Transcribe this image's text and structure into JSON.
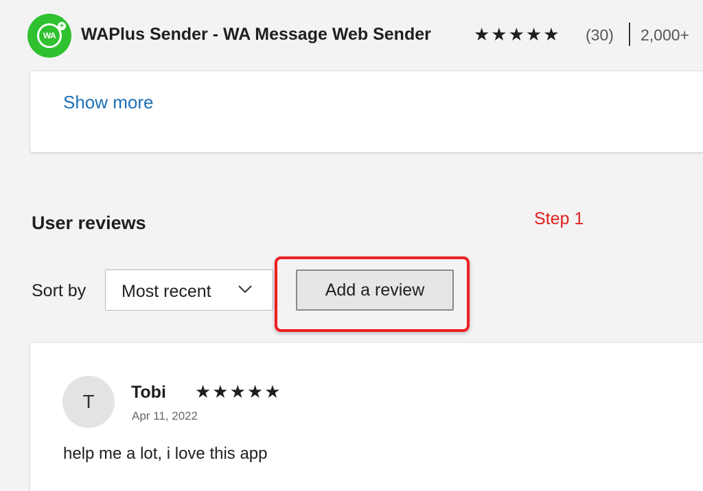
{
  "header": {
    "logo_text": "WA",
    "logo_plus": "+",
    "app_title": "WAPlus Sender - WA Message Web Sender",
    "stars": "★★★★★",
    "rating_count": "(30)",
    "user_count": "2,000+"
  },
  "description": {
    "show_more_label": "Show more"
  },
  "reviews": {
    "section_title": "User reviews",
    "step_annotation": "Step 1",
    "sort_label": "Sort by",
    "sort_selected": "Most recent",
    "add_review_label": "Add a review",
    "items": [
      {
        "avatar_initial": "T",
        "name": "Tobi",
        "stars": "★★★★★",
        "date": "Apr 11, 2022",
        "text": "help me a lot, i love this app"
      }
    ]
  },
  "icons": {
    "sort_chevron": "chevron-down-icon",
    "star": "star-icon"
  },
  "colors": {
    "link": "#1a6fb5",
    "annotation_red": "#e0201d",
    "logo_green": "#2fc12f",
    "page_background": "#f3f3f3"
  }
}
